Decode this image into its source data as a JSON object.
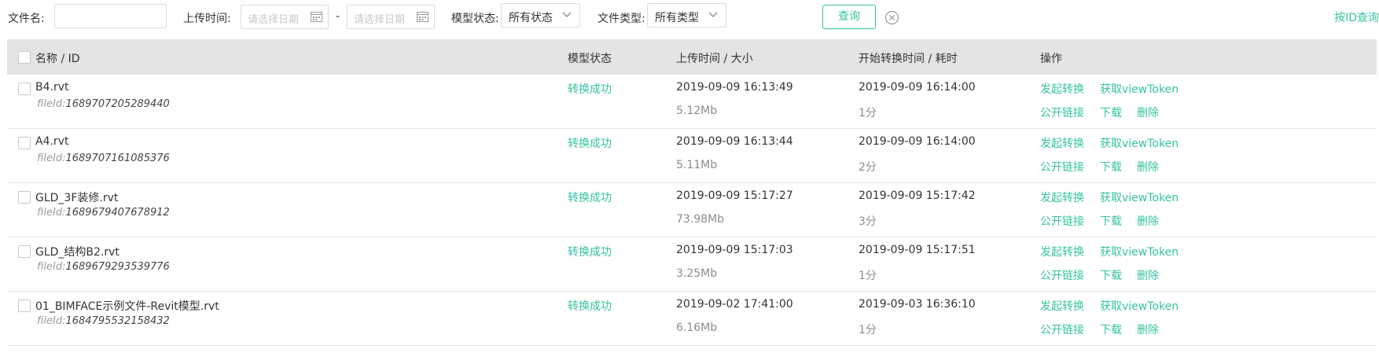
{
  "filter": {
    "filename_label": "文件名:",
    "filename_value": "",
    "upload_time_label": "上传时间:",
    "date_start_placeholder": "请选择日期",
    "date_separator": "-",
    "date_end_placeholder": "请选择日期",
    "model_status_label": "模型状态:",
    "model_status_value": "所有状态",
    "file_type_label": "文件类型:",
    "file_type_value": "所有类型",
    "query_button": "查询",
    "query_by_id_link": "按ID查询"
  },
  "table": {
    "headers": {
      "name": "名称 / ID",
      "status": "模型状态",
      "upload": "上传时间 / 大小",
      "convert": "开始转换时间 / 耗时",
      "actions": "操作"
    },
    "fileid_label": "fileId:",
    "action_labels": {
      "convert": "发起转换",
      "token": "获取viewToken",
      "public_link": "公开链接",
      "download": "下载",
      "delete": "删除"
    },
    "rows": [
      {
        "name": "B4.rvt",
        "file_id": "1689707205289440",
        "status": "转换成功",
        "upload_time": "2019-09-09 16:13:49",
        "size": "5.12Mb",
        "convert_time": "2019-09-09 16:14:00",
        "duration": "1分"
      },
      {
        "name": "A4.rvt",
        "file_id": "1689707161085376",
        "status": "转换成功",
        "upload_time": "2019-09-09 16:13:44",
        "size": "5.11Mb",
        "convert_time": "2019-09-09 16:14:00",
        "duration": "2分"
      },
      {
        "name": "GLD_3F装修.rvt",
        "file_id": "1689679407678912",
        "status": "转换成功",
        "upload_time": "2019-09-09 15:17:27",
        "size": "73.98Mb",
        "convert_time": "2019-09-09 15:17:42",
        "duration": "3分"
      },
      {
        "name": "GLD_结构B2.rvt",
        "file_id": "1689679293539776",
        "status": "转换成功",
        "upload_time": "2019-09-09 15:17:03",
        "size": "3.25Mb",
        "convert_time": "2019-09-09 15:17:51",
        "duration": "1分"
      },
      {
        "name": "01_BIMFACE示例文件-Revit模型.rvt",
        "file_id": "1684795532158432",
        "status": "转换成功",
        "upload_time": "2019-09-02 17:41:00",
        "size": "6.16Mb",
        "convert_time": "2019-09-03 16:36:10",
        "duration": "1分"
      }
    ]
  },
  "colors": {
    "accent": "#36c3a0",
    "header_bg": "#e4e4e4",
    "border": "#dcdcdc"
  },
  "icons": [
    "calendar-icon",
    "chevron-down-icon",
    "clear-circle-icon",
    "checkbox"
  ]
}
